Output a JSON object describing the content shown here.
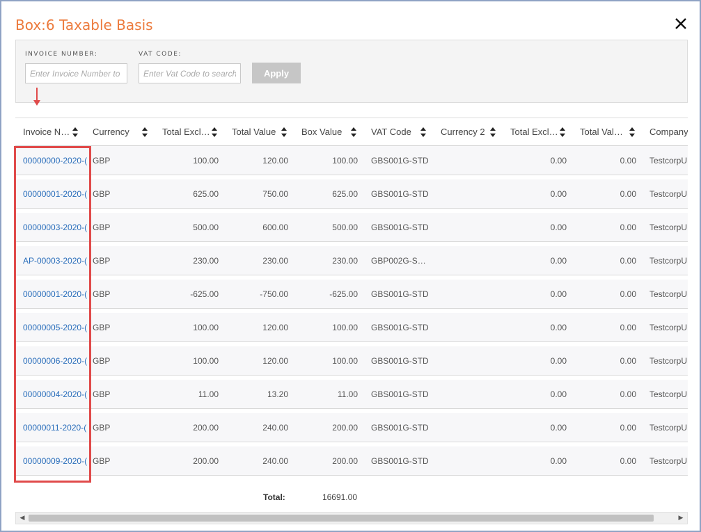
{
  "dialog": {
    "title": "Box:6 Taxable Basis"
  },
  "filters": {
    "invoice_label": "INVOICE NUMBER:",
    "invoice_placeholder": "Enter Invoice Number to",
    "vat_label": "VAT CODE:",
    "vat_placeholder": "Enter Vat Code to search",
    "apply_label": "Apply"
  },
  "columns": [
    "Invoice N…",
    "Currency",
    "Total Excl…",
    "Total Value",
    "Box Value",
    "VAT Code",
    "Currency 2",
    "Total Excl…",
    "Total Val…",
    "Company"
  ],
  "rows": [
    [
      "00000000-2020-(",
      "GBP",
      "100.00",
      "120.00",
      "100.00",
      "GBS001G-STD",
      "",
      "0.00",
      "0.00",
      "TestcorpU"
    ],
    [
      "00000001-2020-(",
      "GBP",
      "625.00",
      "750.00",
      "625.00",
      "GBS001G-STD",
      "",
      "0.00",
      "0.00",
      "TestcorpU"
    ],
    [
      "00000003-2020-(",
      "GBP",
      "500.00",
      "600.00",
      "500.00",
      "GBS001G-STD",
      "",
      "0.00",
      "0.00",
      "TestcorpU"
    ],
    [
      "AP-00003-2020-(",
      "GBP",
      "230.00",
      "230.00",
      "230.00",
      "GBP002G-S…",
      "",
      "0.00",
      "0.00",
      "TestcorpU"
    ],
    [
      "00000001-2020-(",
      "GBP",
      "-625.00",
      "-750.00",
      "-625.00",
      "GBS001G-STD",
      "",
      "0.00",
      "0.00",
      "TestcorpU"
    ],
    [
      "00000005-2020-(",
      "GBP",
      "100.00",
      "120.00",
      "100.00",
      "GBS001G-STD",
      "",
      "0.00",
      "0.00",
      "TestcorpU"
    ],
    [
      "00000006-2020-(",
      "GBP",
      "100.00",
      "120.00",
      "100.00",
      "GBS001G-STD",
      "",
      "0.00",
      "0.00",
      "TestcorpU"
    ],
    [
      "00000004-2020-(",
      "GBP",
      "11.00",
      "13.20",
      "11.00",
      "GBS001G-STD",
      "",
      "0.00",
      "0.00",
      "TestcorpU"
    ],
    [
      "00000011-2020-(",
      "GBP",
      "200.00",
      "240.00",
      "200.00",
      "GBS001G-STD",
      "",
      "0.00",
      "0.00",
      "TestcorpU"
    ],
    [
      "00000009-2020-(",
      "GBP",
      "200.00",
      "240.00",
      "200.00",
      "GBS001G-STD",
      "",
      "0.00",
      "0.00",
      "TestcorpU"
    ]
  ],
  "footer": {
    "total_label": "Total:",
    "total_value": "16691.00"
  },
  "icons": {
    "close": "close-icon",
    "sort": "sort-icon",
    "annotation_arrow": "down-arrow-icon"
  },
  "colors": {
    "title": "#ec7a3c",
    "link": "#2a6ebb",
    "highlight": "#e04a4a",
    "frame": "#8fa3c4"
  }
}
